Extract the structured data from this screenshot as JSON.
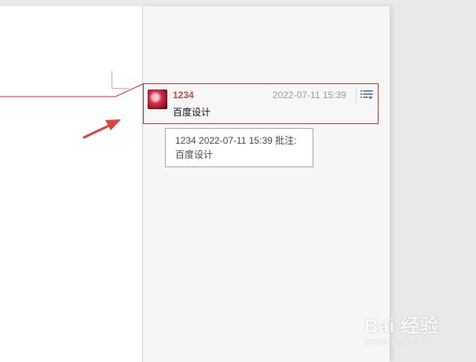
{
  "comment": {
    "author": "1234",
    "timestamp": "2022-07-11 15:39",
    "text": "百度设计",
    "menu_icon": "list-menu-icon"
  },
  "tooltip": {
    "line1": "1234 2022-07-11 15:39 批注:",
    "line2": "百度设计"
  },
  "watermark": {
    "logo": "Bai 经验",
    "url": "jingyan.baidu.com"
  },
  "colors": {
    "accent_red": "#d0323a",
    "author_red": "#c44a4a",
    "pane_bg": "#f6f6f7"
  }
}
